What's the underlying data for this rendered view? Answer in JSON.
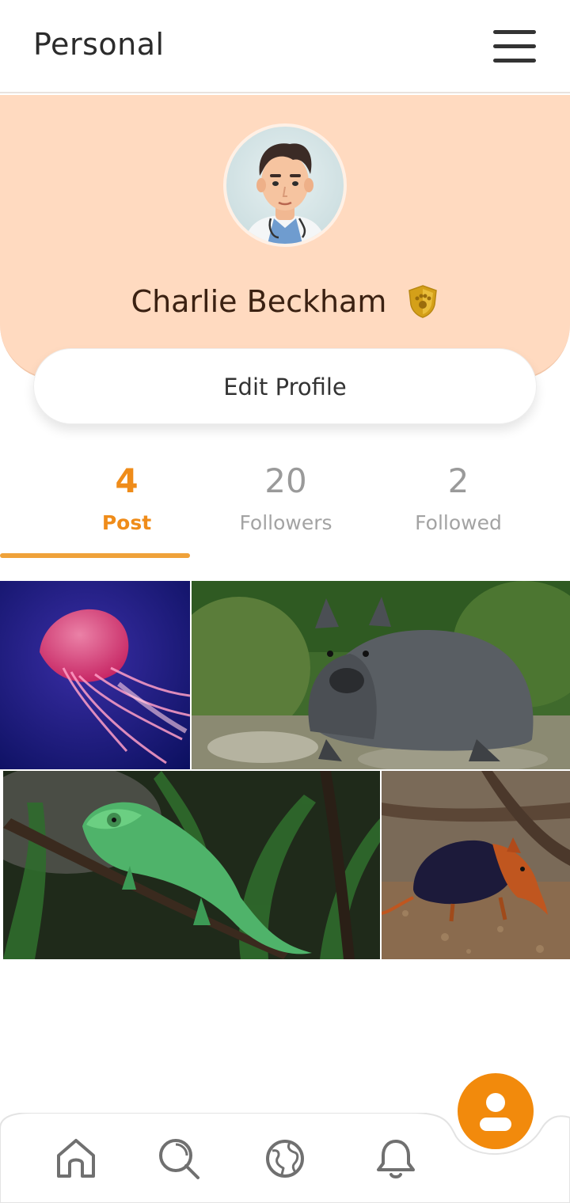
{
  "header": {
    "title": "Personal"
  },
  "profile": {
    "name": "Charlie Beckham",
    "edit_label": "Edit Profile"
  },
  "stats": [
    {
      "value": "4",
      "label": "Post"
    },
    {
      "value": "20",
      "label": "Followers"
    },
    {
      "value": "2",
      "label": "Followed"
    }
  ],
  "active_tab": "Post",
  "posts": [
    {
      "subject": "jellyfish"
    },
    {
      "subject": "wombat"
    },
    {
      "subject": "chameleon"
    },
    {
      "subject": "elephant-shrew"
    }
  ],
  "nav": {
    "items": [
      "home-icon",
      "search-icon",
      "globe-icon",
      "bell-icon"
    ],
    "fab": "profile-icon"
  },
  "colors": {
    "accent": "#ef8c1a",
    "banner": "#ffdac0",
    "fab": "#f28a0c",
    "badge": "#d8a21e"
  }
}
